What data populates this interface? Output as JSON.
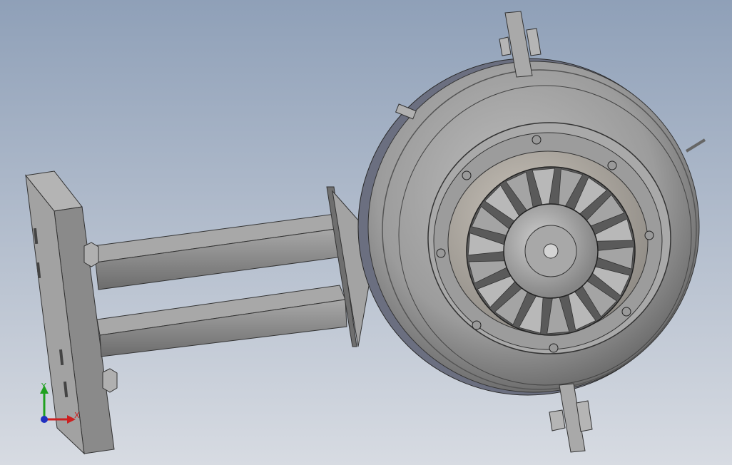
{
  "viewport": {
    "background_top": "#8fa0b8",
    "background_bottom": "#d7dbe2"
  },
  "triad": {
    "x_label": "X",
    "y_label": "Y",
    "x_color": "#cc2020",
    "y_color": "#20a020",
    "z_color": "#2030c0"
  },
  "model": {
    "parts": [
      "mounting-plate",
      "upper-arm",
      "lower-arm",
      "triangular-gusset",
      "engine-housing",
      "fan-rotor",
      "bracket-top",
      "bracket-bottom"
    ],
    "fan_blade_count": 18
  }
}
